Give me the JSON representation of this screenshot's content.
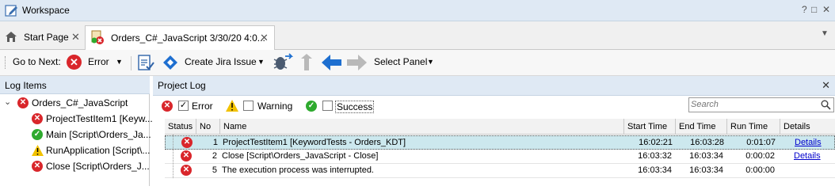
{
  "window": {
    "title": "Workspace",
    "controls": [
      "?",
      "□",
      "✕"
    ]
  },
  "tabs": [
    {
      "label": "Start Page",
      "icon": "home-icon"
    },
    {
      "label": "Orders_C#_JavaScript 3/30/20 4:0...",
      "icon": "test-log-icon"
    }
  ],
  "toolbar": {
    "go_to_next": "Go to Next:",
    "error": "Error",
    "create_jira": "Create Jira Issue",
    "select_panel": "Select Panel"
  },
  "log_items": {
    "header": "Log Items",
    "root": {
      "label": "Orders_C#_JavaScript",
      "status": "error"
    },
    "children": [
      {
        "label": "ProjectTestItem1 [Keyw...",
        "status": "error"
      },
      {
        "label": "Main [Script\\Orders_Ja...",
        "status": "success"
      },
      {
        "label": "RunApplication [Script\\...",
        "status": "warning"
      },
      {
        "label": "Close [Script\\Orders_J...",
        "status": "error"
      }
    ]
  },
  "project_log": {
    "header": "Project Log",
    "filters": {
      "error": "Error",
      "warning": "Warning",
      "success": "Success"
    },
    "search_placeholder": "Search",
    "columns": [
      "Status",
      "No",
      "Name",
      "Start Time",
      "End Time",
      "Run Time",
      "Details"
    ],
    "rows": [
      {
        "status": "error",
        "no": "1",
        "name": "ProjectTestItem1 [KeywordTests - Orders_KDT]",
        "start": "16:02:21",
        "end": "16:03:28",
        "run": "0:01:07",
        "details": "Details"
      },
      {
        "status": "error",
        "no": "2",
        "name": "Close [Script\\Orders_JavaScript - Close]",
        "start": "16:03:32",
        "end": "16:03:34",
        "run": "0:00:02",
        "details": "Details"
      },
      {
        "status": "error",
        "no": "5",
        "name": "The execution process was interrupted.",
        "start": "16:03:34",
        "end": "16:03:34",
        "run": "0:00:00",
        "details": ""
      }
    ]
  },
  "colors": {
    "error": "#d9262b",
    "success": "#2eaa2e",
    "warning": "#f2c200",
    "accent": "#1e6fd0",
    "selected_row": "#cce8ee"
  }
}
